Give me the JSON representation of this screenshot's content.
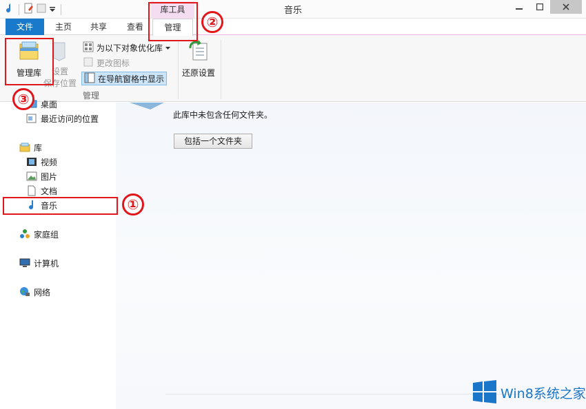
{
  "window": {
    "title": "音乐"
  },
  "ribbon_tabs": [
    {
      "label": "文件"
    },
    {
      "label": "主页"
    },
    {
      "label": "共享"
    },
    {
      "label": "查看"
    }
  ],
  "context_tab": {
    "header": "库工具",
    "label": "管理"
  },
  "ribbon": {
    "manage_library": "管理库",
    "set_save_location_line1": "设置",
    "set_save_location_line2": "保存位置",
    "optimize_for": "为以下对象优化库",
    "change_icon": "更改图标",
    "show_in_nav": "在导航窗格中显示",
    "group_label": "管理",
    "restore_settings": "还原设置"
  },
  "nav": {
    "desktop": "桌面",
    "recent": "最近访问的位置",
    "libraries": "库",
    "videos": "视频",
    "pictures": "图片",
    "documents": "文档",
    "music": "音乐",
    "homegroup": "家庭组",
    "computer": "计算机",
    "network": "网络"
  },
  "content": {
    "empty_message": "此库中未包含任何文件夹。",
    "include_folder_button": "包括一个文件夹"
  },
  "annotations": [
    "①",
    "②",
    "③"
  ],
  "watermark": {
    "text": "Win8系统之家"
  },
  "colors": {
    "file_tab": "#1979ca",
    "context_tab": "#f4dcf1",
    "annotation": "#e0161b",
    "watermark": "#1a76c9"
  }
}
